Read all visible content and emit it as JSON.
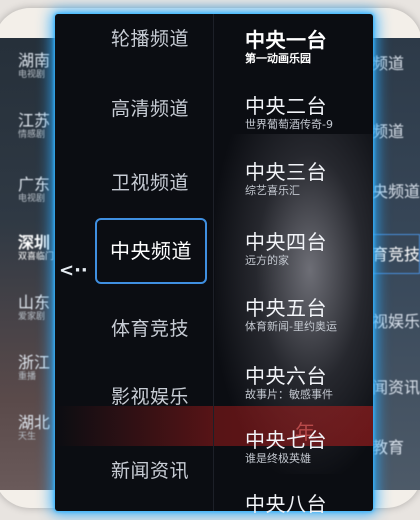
{
  "left_bg": [
    {
      "name": "湖南",
      "sub": "电视剧"
    },
    {
      "name": "江苏",
      "sub": "情感剧"
    },
    {
      "name": "广东",
      "sub": "电视剧"
    },
    {
      "name": "深圳",
      "sub": "双喜临门"
    },
    {
      "name": "山东",
      "sub": "爱家剧"
    },
    {
      "name": "浙江",
      "sub": "重播"
    },
    {
      "name": "湖北",
      "sub": "天生"
    }
  ],
  "right_bg": [
    "频道",
    "频道",
    "央频道",
    "育竞技",
    "视娱乐",
    "闻资讯",
    "教育"
  ],
  "back_label": "<··",
  "categories": [
    "轮播频道",
    "高清频道",
    "卫视频道",
    "中央频道",
    "体育竞技",
    "影视娱乐",
    "新闻资讯"
  ],
  "selected_category": "中央频道",
  "channels": [
    {
      "name": "中央一台",
      "program": "第一动画乐园"
    },
    {
      "name": "中央二台",
      "program": "世界葡萄酒传奇-9"
    },
    {
      "name": "中央三台",
      "program": "综艺喜乐汇"
    },
    {
      "name": "中央四台",
      "program": "远方的家"
    },
    {
      "name": "中央五台",
      "program": "体育新闻-里约奥运"
    },
    {
      "name": "中央六台",
      "program": "故事片：敏感事件"
    },
    {
      "name": "中央七台",
      "program": "谁是终极英雄"
    },
    {
      "name": "中央八台",
      "program": ""
    }
  ],
  "banner_text": "年"
}
